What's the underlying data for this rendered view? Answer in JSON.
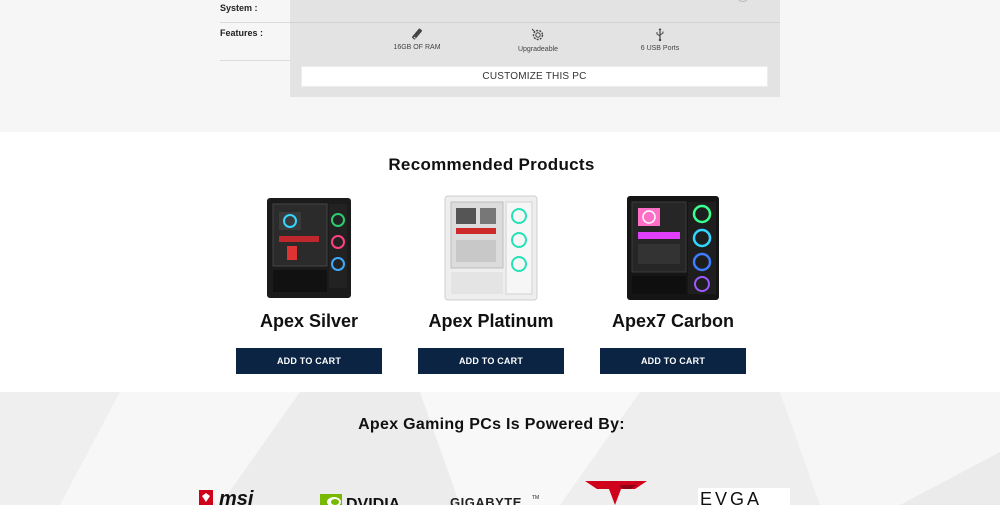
{
  "specs": {
    "system_label": "System :",
    "features_label": "Features :",
    "features": [
      {
        "icon": "ram-icon",
        "label": "16GB OF RAM"
      },
      {
        "icon": "upgrade-gear-icon",
        "label": "Upgradeable"
      },
      {
        "icon": "usb-icon",
        "label": "6 USB Ports"
      }
    ],
    "customize_label": "CUSTOMIZE THIS PC"
  },
  "recommended": {
    "title": "Recommended Products",
    "products": [
      {
        "name": "Apex Silver",
        "button": "ADD TO CART",
        "case_color": "#1b1b1b"
      },
      {
        "name": "Apex Platinum",
        "button": "ADD TO CART",
        "case_color": "#eeeeee"
      },
      {
        "name": "Apex7 Carbon",
        "button": "ADD TO CART",
        "case_color": "#151515"
      }
    ]
  },
  "powered": {
    "title": "Apex Gaming PCs Is Powered By:",
    "logos": [
      {
        "name": "msi",
        "text": "msi",
        "color": "#d0021b"
      },
      {
        "name": "nvidia",
        "text": "DVIDIA",
        "color": "#76b900"
      },
      {
        "name": "gigabyte",
        "text": "GIGABYTE",
        "color": "#222222"
      },
      {
        "name": "teamgroup",
        "color": "#d0021b"
      },
      {
        "name": "evga",
        "text": "EVGA",
        "color": "#111111"
      }
    ]
  },
  "colors": {
    "button_bg": "#0b2444",
    "panel_bg": "#e3e3e3"
  }
}
